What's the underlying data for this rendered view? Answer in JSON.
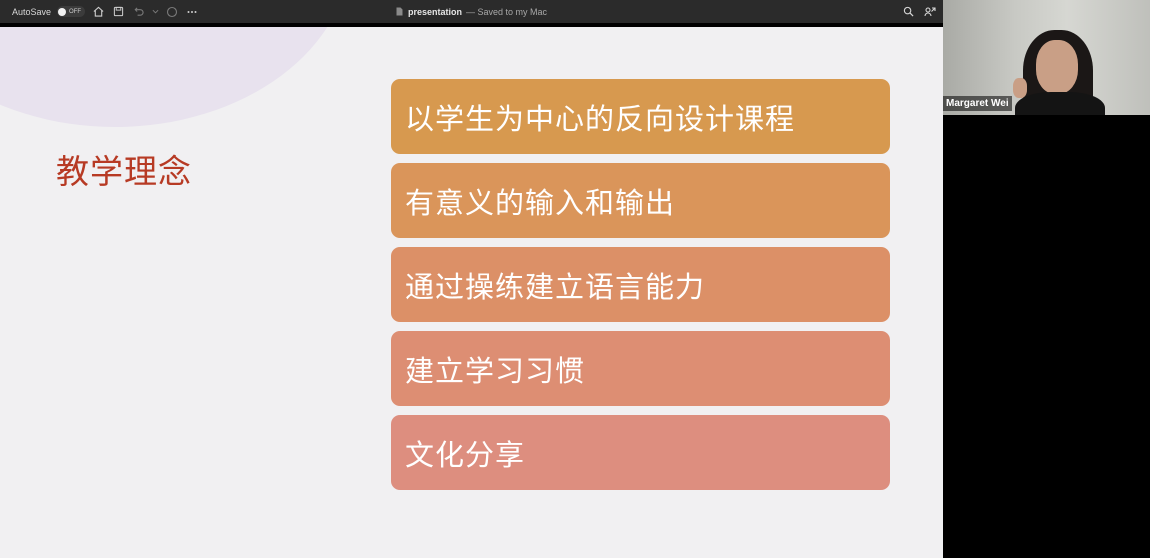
{
  "toolbar": {
    "autosave_label": "AutoSave",
    "autosave_state": "OFF",
    "document_name": "presentation",
    "save_status": "— Saved to my Mac",
    "icons": [
      "home-icon",
      "save-icon",
      "undo-icon",
      "chevron-down-icon",
      "redo-icon",
      "more-icon",
      "search-icon",
      "share-icon"
    ]
  },
  "slide": {
    "title": "教学理念",
    "items": [
      {
        "label": "以学生为中心的反向设计课程",
        "color": "#d7994f"
      },
      {
        "label": "有意义的输入和输出",
        "color": "#da955a"
      },
      {
        "label": "通过操练建立语言能力",
        "color": "#dc9067"
      },
      {
        "label": "建立学习习惯",
        "color": "#dd8e73"
      },
      {
        "label": "文化分享",
        "color": "#dd8e7f"
      }
    ],
    "title_color": "#b73a24",
    "background": "#f1f0f2"
  },
  "participant": {
    "name": "Margaret Wei"
  }
}
